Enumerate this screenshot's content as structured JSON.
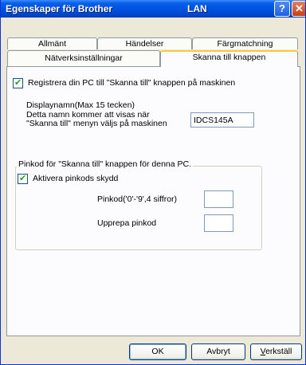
{
  "window": {
    "title": "Egenskaper för Brother",
    "title_suffix": "LAN",
    "help_glyph": "?",
    "close_glyph": "✕"
  },
  "tabs": {
    "row1": [
      "Allmänt",
      "Händelser",
      "Färgmatchning"
    ],
    "row2": [
      "Nätverksinställningar",
      "Skanna till knappen"
    ],
    "active": "Skanna till knappen"
  },
  "register": {
    "checked": true,
    "label": "Registrera din PC till \"Skanna till\" knappen på maskinen"
  },
  "display_name": {
    "line1": "Displaynamn(Max 15 tecken)",
    "line2": "Detta namn kommer att visas när",
    "line3": "\"Skanna till\" menyn väljs på maskinen",
    "value": "IDCS145A"
  },
  "pin_group": {
    "legend": "Pinkod för \"Skanna till\" knappen för denna PC.",
    "enable_checked": true,
    "enable_label": "Aktivera pinkods skydd",
    "pin_label": "Pinkod('0'-'9',4 siffror)",
    "pin_value": "",
    "repeat_label": "Upprepa pinkod",
    "repeat_value": ""
  },
  "buttons": {
    "ok": "OK",
    "cancel": "Avbryt",
    "apply": "Verkställ"
  }
}
